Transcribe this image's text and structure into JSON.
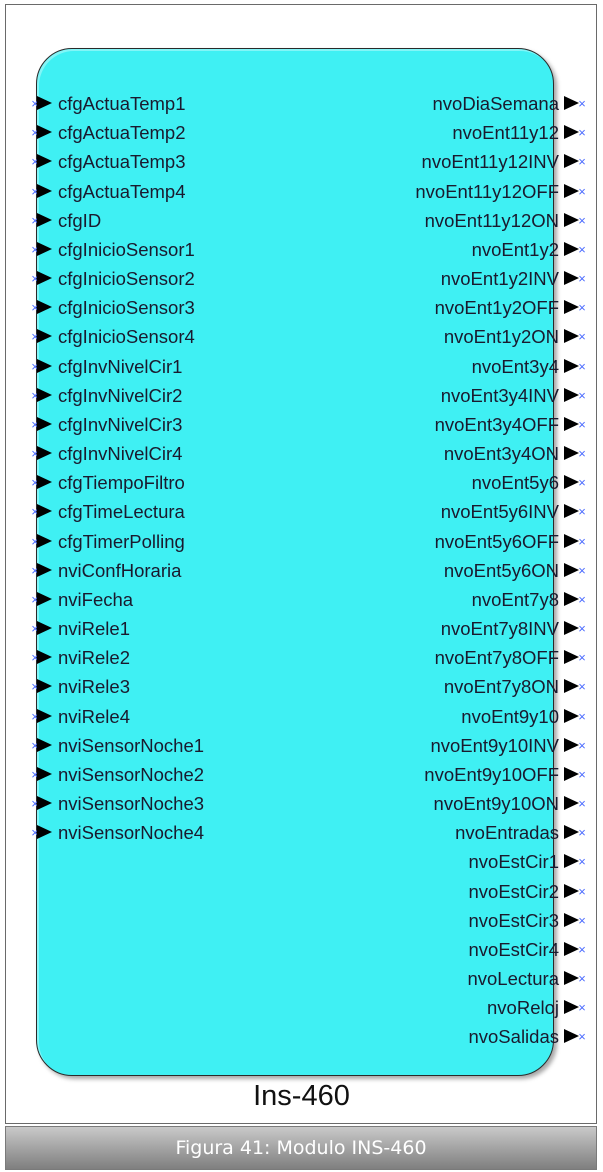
{
  "module": {
    "name": "Ins-460",
    "fill_color": "#3ff0f3",
    "inputs": [
      "cfgActuaTemp1",
      "cfgActuaTemp2",
      "cfgActuaTemp3",
      "cfgActuaTemp4",
      "cfgID",
      "cfgInicioSensor1",
      "cfgInicioSensor2",
      "cfgInicioSensor3",
      "cfgInicioSensor4",
      "cfgInvNivelCir1",
      "cfgInvNivelCir2",
      "cfgInvNivelCir3",
      "cfgInvNivelCir4",
      "cfgTiempoFiltro",
      "cfgTimeLectura",
      "cfgTimerPolling",
      "nviConfHoraria",
      "nviFecha",
      "nviRele1",
      "nviRele2",
      "nviRele3",
      "nviRele4",
      "nviSensorNoche1",
      "nviSensorNoche2",
      "nviSensorNoche3",
      "nviSensorNoche4"
    ],
    "outputs": [
      "nvoDiaSemana",
      "nvoEnt11y12",
      "nvoEnt11y12INV",
      "nvoEnt11y12OFF",
      "nvoEnt11y12ON",
      "nvoEnt1y2",
      "nvoEnt1y2INV",
      "nvoEnt1y2OFF",
      "nvoEnt1y2ON",
      "nvoEnt3y4",
      "nvoEnt3y4INV",
      "nvoEnt3y4OFF",
      "nvoEnt3y4ON",
      "nvoEnt5y6",
      "nvoEnt5y6INV",
      "nvoEnt5y6OFF",
      "nvoEnt5y6ON",
      "nvoEnt7y8",
      "nvoEnt7y8INV",
      "nvoEnt7y8OFF",
      "nvoEnt7y8ON",
      "nvoEnt9y10",
      "nvoEnt9y10INV",
      "nvoEnt9y10OFF",
      "nvoEnt9y10ON",
      "nvoEntradas",
      "nvoEstCir1",
      "nvoEstCir2",
      "nvoEstCir3",
      "nvoEstCir4",
      "nvoLectura",
      "nvoReloj",
      "nvoSalidas"
    ]
  },
  "caption": "Figura 41: Modulo INS-460"
}
